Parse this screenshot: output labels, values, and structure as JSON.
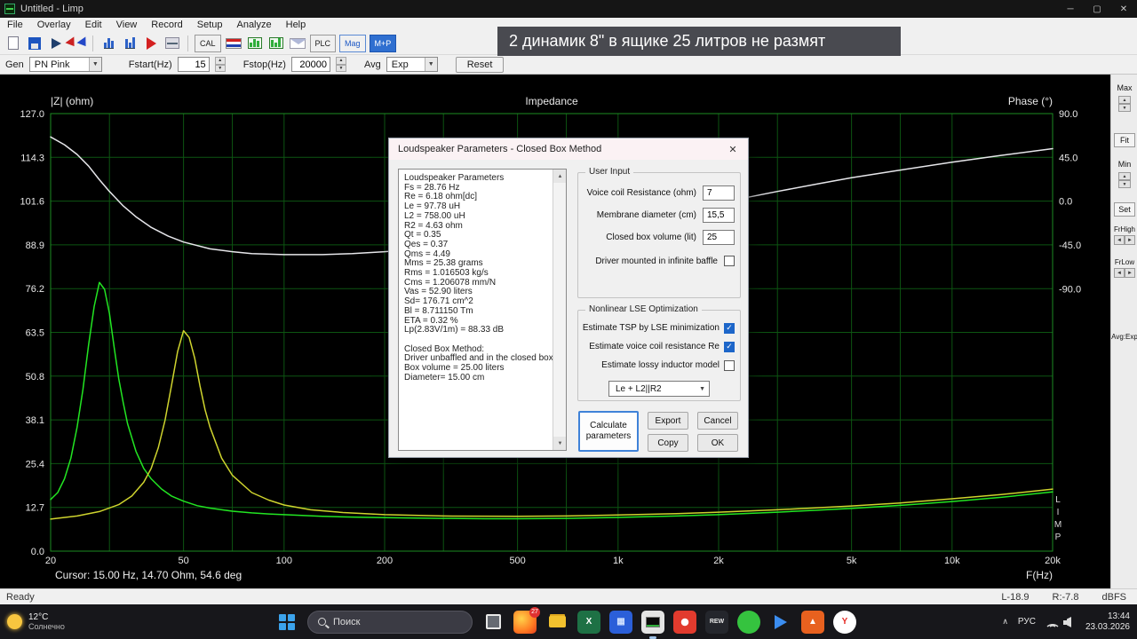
{
  "window": {
    "title": "Untitled - Limp",
    "minimize": "─",
    "maximize": "▢",
    "close": "✕"
  },
  "menu": {
    "items": [
      "File",
      "Overlay",
      "Edit",
      "View",
      "Record",
      "Setup",
      "Analyze",
      "Help"
    ]
  },
  "toolbar": {
    "cal_label": "CAL",
    "plc_label": "PLC",
    "mag_label": "Mag",
    "mp_label": "M+P"
  },
  "controls": {
    "gen_label": "Gen",
    "gen_value": "PN Pink",
    "fstart_label": "Fstart(Hz)",
    "fstart_value": "15",
    "fstop_label": "Fstop(Hz)",
    "fstop_value": "20000",
    "avg_label": "Avg",
    "avg_value": "Exp",
    "reset_label": "Reset"
  },
  "banner": {
    "text": "2 динамик 8\" в ящике 25 литров не размят"
  },
  "chart": {
    "ylabel_left": "|Z| (ohm)",
    "title": "Impedance",
    "ylabel_right": "Phase (°)",
    "xlabel": "F(Hz)",
    "cursor_text": "Cursor: 15.00 Hz, 14.70 Ohm, 54.6 deg",
    "limp_watermark": "LIMP",
    "z_tick_labels": [
      "127.0",
      "114.3",
      "101.6",
      "88.9",
      "76.2",
      "63.5",
      "50.8",
      "38.1",
      "25.4",
      "12.7",
      "0.0"
    ],
    "phase_ticks": [
      {
        "deg": 90,
        "label": "90.0"
      },
      {
        "deg": 45,
        "label": "45.0"
      },
      {
        "deg": 0,
        "label": "0.0"
      },
      {
        "deg": -45,
        "label": "-45.0"
      },
      {
        "deg": -90,
        "label": "-90.0"
      }
    ],
    "x_ticks": [
      {
        "f": 20,
        "label": "20"
      },
      {
        "f": 50,
        "label": "50"
      },
      {
        "f": 100,
        "label": "100"
      },
      {
        "f": 200,
        "label": "200"
      },
      {
        "f": 500,
        "label": "500"
      },
      {
        "f": 1000,
        "label": "1k"
      },
      {
        "f": 2000,
        "label": "2k"
      },
      {
        "f": 5000,
        "label": "5k"
      },
      {
        "f": 10000,
        "label": "10k"
      },
      {
        "f": 20000,
        "label": "20k"
      }
    ],
    "grid_freqs": [
      20,
      30,
      50,
      70,
      100,
      200,
      300,
      500,
      700,
      1000,
      2000,
      3000,
      5000,
      7000,
      10000,
      20000
    ],
    "colors": {
      "grid": "#0d5512",
      "frame": "#1d8c22",
      "bg": "#000000"
    }
  },
  "chart_data": {
    "type": "line",
    "x_axis": {
      "scale": "log",
      "min": 20,
      "max": 20000,
      "unit": "Hz"
    },
    "y_left_axis": {
      "label": "|Z| (ohm)",
      "min": 0,
      "max": 127
    },
    "y_right_axis": {
      "label": "Phase (°)",
      "min": -90,
      "max": 90
    },
    "series": [
      {
        "name": "impedance-free-air",
        "color": "#22e522",
        "axis": "left",
        "points": [
          [
            20,
            15
          ],
          [
            21,
            17
          ],
          [
            22,
            21
          ],
          [
            23,
            27
          ],
          [
            24,
            36
          ],
          [
            25,
            47
          ],
          [
            26,
            60
          ],
          [
            27,
            71
          ],
          [
            28,
            78
          ],
          [
            29,
            76
          ],
          [
            30,
            69
          ],
          [
            31,
            59
          ],
          [
            32,
            50
          ],
          [
            33,
            43
          ],
          [
            34,
            37
          ],
          [
            36,
            29
          ],
          [
            38,
            24
          ],
          [
            40,
            21
          ],
          [
            43,
            18
          ],
          [
            46,
            16
          ],
          [
            50,
            14.5
          ],
          [
            55,
            13.2
          ],
          [
            60,
            12.5
          ],
          [
            70,
            11.6
          ],
          [
            80,
            11.1
          ],
          [
            90,
            10.8
          ],
          [
            100,
            10.6
          ],
          [
            130,
            10.1
          ],
          [
            160,
            9.9
          ],
          [
            200,
            9.7
          ],
          [
            300,
            9.5
          ],
          [
            400,
            9.4
          ],
          [
            500,
            9.4
          ],
          [
            700,
            9.5
          ],
          [
            1000,
            9.8
          ],
          [
            1500,
            10.2
          ],
          [
            2000,
            10.6
          ],
          [
            3000,
            11.3
          ],
          [
            4000,
            11.9
          ],
          [
            5000,
            12.4
          ],
          [
            7000,
            13.3
          ],
          [
            10000,
            14.4
          ],
          [
            14000,
            15.6
          ],
          [
            20000,
            17.2
          ]
        ]
      },
      {
        "name": "impedance-closed-box",
        "color": "#cfd42e",
        "axis": "left",
        "points": [
          [
            20,
            9.3
          ],
          [
            24,
            10.2
          ],
          [
            28,
            11.5
          ],
          [
            32,
            13.5
          ],
          [
            35,
            16
          ],
          [
            38,
            20
          ],
          [
            40,
            24
          ],
          [
            42,
            30
          ],
          [
            44,
            38
          ],
          [
            46,
            48
          ],
          [
            48,
            58
          ],
          [
            50,
            64
          ],
          [
            52,
            62
          ],
          [
            54,
            56
          ],
          [
            56,
            48
          ],
          [
            58,
            41
          ],
          [
            60,
            36
          ],
          [
            65,
            27
          ],
          [
            70,
            22
          ],
          [
            80,
            17
          ],
          [
            90,
            14.8
          ],
          [
            100,
            13.4
          ],
          [
            120,
            12
          ],
          [
            150,
            11.2
          ],
          [
            200,
            10.6
          ],
          [
            300,
            10.2
          ],
          [
            500,
            10.1
          ],
          [
            700,
            10.2
          ],
          [
            1000,
            10.5
          ],
          [
            1500,
            10.9
          ],
          [
            2000,
            11.3
          ],
          [
            3000,
            12
          ],
          [
            5000,
            13.1
          ],
          [
            7000,
            14
          ],
          [
            10000,
            15.2
          ],
          [
            14000,
            16.4
          ],
          [
            20000,
            18
          ]
        ]
      },
      {
        "name": "phase",
        "color": "#e6e6ea",
        "axis": "right",
        "points": [
          [
            20,
            66
          ],
          [
            22,
            58
          ],
          [
            24,
            48
          ],
          [
            26,
            36
          ],
          [
            28,
            22
          ],
          [
            30,
            10
          ],
          [
            33,
            -5
          ],
          [
            36,
            -16
          ],
          [
            40,
            -27
          ],
          [
            45,
            -36
          ],
          [
            50,
            -42
          ],
          [
            60,
            -49
          ],
          [
            70,
            -52
          ],
          [
            80,
            -54
          ],
          [
            100,
            -55
          ],
          [
            130,
            -55
          ],
          [
            160,
            -54
          ],
          [
            200,
            -52
          ],
          [
            300,
            -47
          ],
          [
            400,
            -42
          ],
          [
            500,
            -38
          ],
          [
            700,
            -30
          ],
          [
            1000,
            -21
          ],
          [
            1500,
            -10
          ],
          [
            2000,
            -2
          ],
          [
            3000,
            10
          ],
          [
            4000,
            18
          ],
          [
            5000,
            24
          ],
          [
            7000,
            32
          ],
          [
            10000,
            40
          ],
          [
            14000,
            47
          ],
          [
            20000,
            54
          ]
        ]
      }
    ]
  },
  "right_strip": {
    "max_label": "Max",
    "fit_label": "Fit",
    "min_label": "Min",
    "set_label": "Set",
    "frhigh_label": "FrHigh",
    "frlow_label": "FrLow",
    "avg_label": "Avg:Exp"
  },
  "dialog": {
    "title": "Loudspeaker Parameters - Closed Box Method",
    "close_glyph": "✕",
    "param_lines": [
      "Loudspeaker Parameters",
      "Fs = 28.76 Hz",
      "Re = 6.18 ohm[dc]",
      "Le = 97.78 uH",
      "L2 = 758.00 uH",
      "R2 = 4.63 ohm",
      "Qt = 0.35",
      "Qes = 0.37",
      "Qms = 4.49",
      "Mms = 25.38 grams",
      "Rms = 1.016503 kg/s",
      "Cms = 1.206078 mm/N",
      "Vas = 52.90 liters",
      "Sd= 176.71 cm^2",
      "Bl = 8.711150 Tm",
      "ETA = 0.32 %",
      "Lp(2.83V/1m) = 88.33 dB",
      "",
      "Closed Box Method:",
      "Driver unbaffled and in the closed box",
      "Box volume = 25.00 liters",
      "Diameter= 15.00 cm"
    ],
    "user_input": {
      "title": "User Input",
      "fields": [
        {
          "name": "voice-coil-resistance",
          "label": "Voice coil Resistance (ohm)",
          "value": "7"
        },
        {
          "name": "membrane-diameter",
          "label": "Membrane diameter (cm)",
          "value": "15,5"
        },
        {
          "name": "closed-box-volume",
          "label": "Closed box volume (lit)",
          "value": "25"
        }
      ],
      "baffle_checkbox": {
        "label": "Driver mounted in infinite baffle",
        "checked": false
      }
    },
    "lse": {
      "title": "Nonlinear LSE Optimization",
      "options": [
        {
          "name": "estimate-tsp",
          "label": "Estimate TSP by LSE minimization",
          "checked": true
        },
        {
          "name": "estimate-re",
          "label": "Estimate voice coil resistance Re",
          "checked": true
        },
        {
          "name": "estimate-inductor",
          "label": "Estimate lossy inductor model",
          "checked": false
        }
      ],
      "model_select": "Le + L2||R2"
    },
    "buttons": {
      "calculate": "Calculate parameters",
      "export": "Export",
      "cancel": "Cancel",
      "copy": "Copy",
      "ok": "OK"
    }
  },
  "status": {
    "ready": "Ready",
    "left_level": "L-18.9",
    "right_level": "R:-7.8",
    "unit": "dBFS"
  },
  "taskbar": {
    "weather": {
      "temp": "12°C",
      "condition": "Солнечно"
    },
    "search_label": "Поиск",
    "apps": [
      {
        "name": "task-view-icon",
        "style": "taskview"
      },
      {
        "name": "firefox-icon",
        "style": "firefox",
        "badge": "27"
      },
      {
        "name": "folder-icon",
        "style": "folder"
      },
      {
        "name": "excel-icon",
        "style": "excel",
        "letter": "X"
      },
      {
        "name": "blue-app-icon",
        "style": "blueapp",
        "letter": "▦"
      },
      {
        "name": "limp-app-icon",
        "style": "limp",
        "active": true
      },
      {
        "name": "chrome-icon",
        "style": "chrome"
      },
      {
        "name": "rew-icon",
        "style": "rew",
        "letter": "REW"
      },
      {
        "name": "green-app-icon",
        "style": "greenapp"
      },
      {
        "name": "player-icon",
        "style": "player"
      },
      {
        "name": "orange-app-icon",
        "style": "orangeapp",
        "letter": "▲"
      },
      {
        "name": "yandex-icon",
        "style": "yandex",
        "letter": "Y"
      }
    ],
    "tray": {
      "chevron": "∧",
      "lang": "РУС",
      "time": "13:44",
      "date": "23.03.2026"
    }
  }
}
